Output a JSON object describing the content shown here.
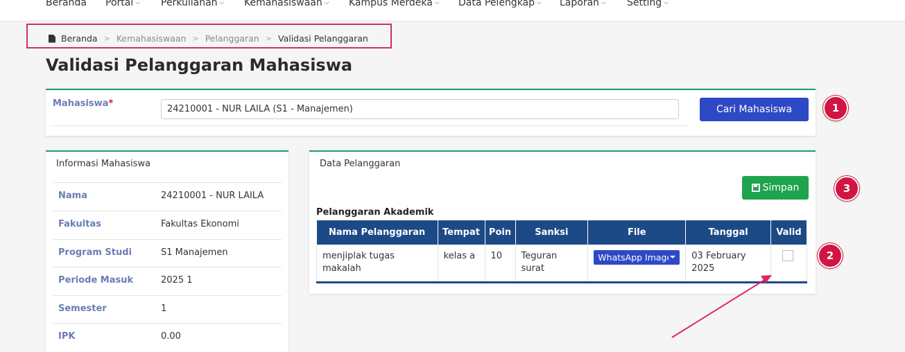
{
  "nav": {
    "items": [
      {
        "label": "Beranda",
        "has_dropdown": false
      },
      {
        "label": "Portal",
        "has_dropdown": true
      },
      {
        "label": "Perkuliahan",
        "has_dropdown": true
      },
      {
        "label": "Kemahasiswaan",
        "has_dropdown": true
      },
      {
        "label": "Kampus Merdeka",
        "has_dropdown": true
      },
      {
        "label": "Data Pelengkap",
        "has_dropdown": true
      },
      {
        "label": "Laporan",
        "has_dropdown": true
      },
      {
        "label": "Setting",
        "has_dropdown": true
      }
    ]
  },
  "breadcrumb": {
    "items": [
      "Beranda",
      "Kemahasiswaan",
      "Pelanggaran",
      "Validasi Pelanggaran"
    ]
  },
  "page_title": "Validasi Pelanggaran Mahasiswa",
  "search": {
    "label": "Mahasiswa",
    "required_mark": "*",
    "value": "24210001 - NUR LAILA (S1 - Manajemen)",
    "button_label": "Cari Mahasiswa"
  },
  "info": {
    "title": "Informasi Mahasiswa",
    "rows": [
      {
        "key": "Nama",
        "value": "24210001 - NUR LAILA"
      },
      {
        "key": "Fakultas",
        "value": "Fakultas Ekonomi"
      },
      {
        "key": "Program Studi",
        "value": "S1 Manajemen"
      },
      {
        "key": "Periode Masuk",
        "value": "2025 1"
      },
      {
        "key": "Semester",
        "value": "1"
      },
      {
        "key": "IPK",
        "value": "0.00"
      }
    ]
  },
  "violations": {
    "title": "Data Pelanggaran",
    "save_label": "Simpan",
    "section_title": "Pelanggaran Akademik",
    "columns": [
      "Nama Pelanggaran",
      "Tempat",
      "Poin",
      "Sanksi",
      "File",
      "Tanggal",
      "Valid"
    ],
    "rows": [
      {
        "nama": "menjiplak tugas makalah",
        "tempat": "kelas a",
        "poin": "10",
        "sanksi": "Teguran surat",
        "file": "WhatsApp Image",
        "tanggal": "03 February 2025",
        "valid": false
      }
    ]
  },
  "markers": [
    "1",
    "2",
    "3"
  ],
  "colors": {
    "primary_blue": "#2e49c6",
    "table_header": "#1c4a86",
    "success_green": "#1ea44d",
    "panel_accent": "#1e9e64",
    "marker_red": "#d01543",
    "highlight_border": "#cc2f73"
  }
}
